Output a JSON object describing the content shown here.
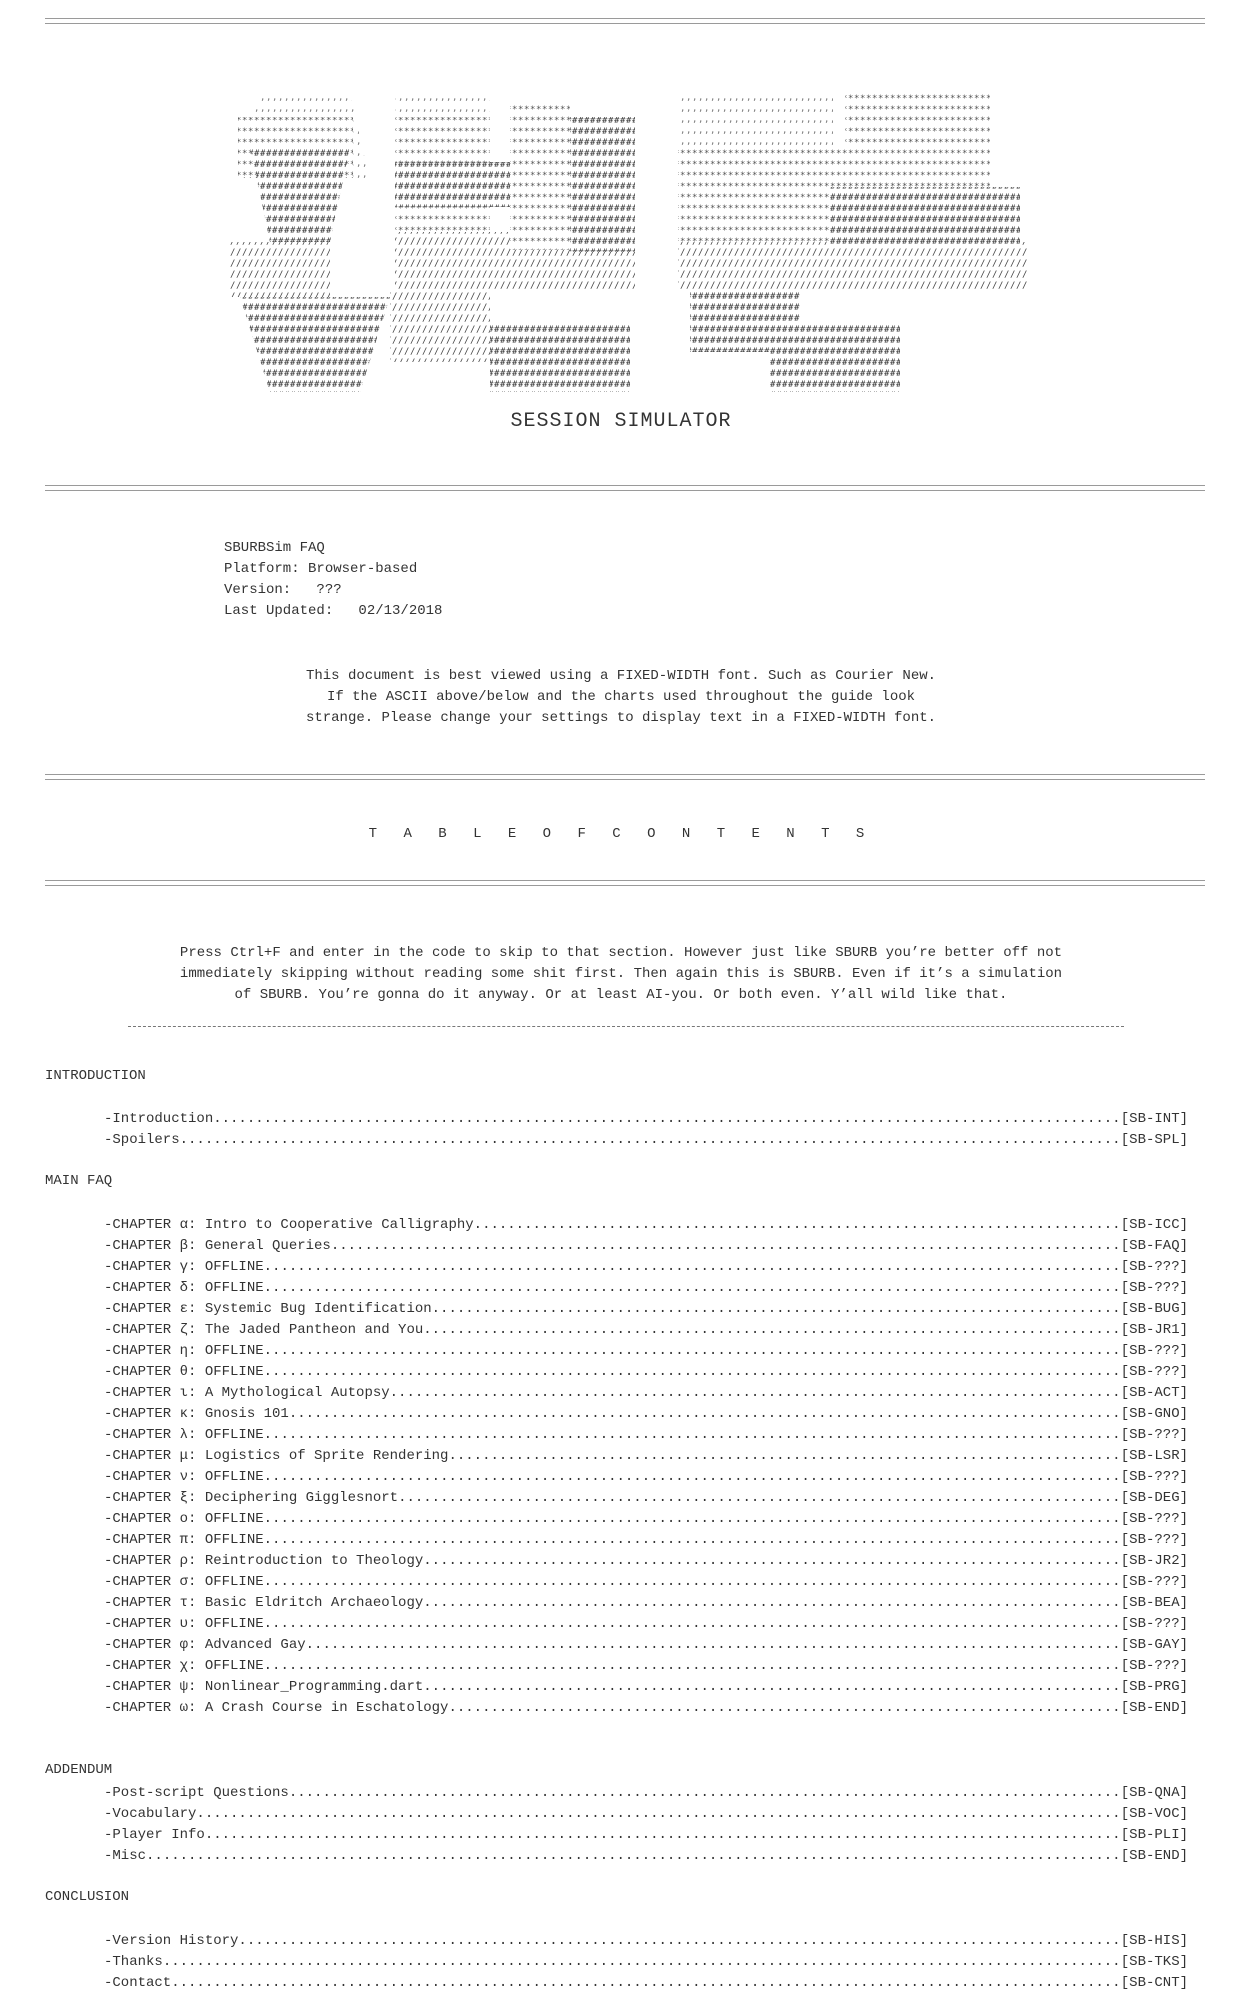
{
  "logo": {
    "title": "SESSION SIMULATOR",
    "image_alt": "SBURB ASCII art logo"
  },
  "meta": {
    "name": "SBURBSim FAQ",
    "platform": "Platform: Browser-based",
    "version": "Version:   ???",
    "updated": "Last Updated:   02/13/2018"
  },
  "notice": [
    "This document is best viewed using a FIXED-WIDTH font. Such as Courier New.",
    "If the ASCII above/below and the charts used throughout the guide look",
    "strange. Please change your settings to display text in a FIXED-WIDTH font."
  ],
  "toc_title": "T A B L E   O F   C O N T E N T S",
  "intro_text": [
    "Press Ctrl+F and enter in the code to skip to that section. However just like SBURB you’re better off not",
    "immediately skipping without reading some shit first. Then again this is SBURB. Even if it’s a simulation",
    "of SBURB. You’re gonna do it anyway. Or at least AI-you. Or both even. Y’all wild like that."
  ],
  "sections": {
    "introduction": {
      "heading": "INTRODUCTION",
      "entries": [
        {
          "label": "-Introduction",
          "code": "[SB-INT]"
        },
        {
          "label": "-Spoilers",
          "code": "[SB-SPL]"
        }
      ]
    },
    "main_faq": {
      "heading": "MAIN FAQ",
      "entries": [
        {
          "label": "-CHAPTER α: Intro to Cooperative Calligraphy",
          "code": "[SB-ICC]"
        },
        {
          "label": "-CHAPTER β: General Queries",
          "code": "[SB-FAQ]"
        },
        {
          "label": "-CHAPTER γ: OFFLINE",
          "code": "[SB-???]"
        },
        {
          "label": "-CHAPTER δ: OFFLINE",
          "code": "[SB-???]"
        },
        {
          "label": "-CHAPTER ε: Systemic Bug Identification",
          "code": "[SB-BUG]"
        },
        {
          "label": "-CHAPTER ζ: The Jaded Pantheon and You",
          "code": "[SB-JR1]"
        },
        {
          "label": "-CHAPTER η: OFFLINE",
          "code": "[SB-???]"
        },
        {
          "label": "-CHAPTER θ: OFFLINE",
          "code": "[SB-???]"
        },
        {
          "label": "-CHAPTER ι: A Mythological Autopsy",
          "code": "[SB-ACT]"
        },
        {
          "label": "-CHAPTER κ: Gnosis 101",
          "code": "[SB-GNO]"
        },
        {
          "label": "-CHAPTER λ: OFFLINE",
          "code": "[SB-???]"
        },
        {
          "label": "-CHAPTER μ: Logistics of Sprite Rendering",
          "code": "[SB-LSR]"
        },
        {
          "label": "-CHAPTER ν: OFFLINE",
          "code": "[SB-???]"
        },
        {
          "label": "-CHAPTER ξ: Deciphering Gigglesnort",
          "code": "[SB-DEG]"
        },
        {
          "label": "-CHAPTER ο: OFFLINE",
          "code": "[SB-???]"
        },
        {
          "label": "-CHAPTER π: OFFLINE",
          "code": "[SB-???]"
        },
        {
          "label": "-CHAPTER ρ: Reintroduction to Theology",
          "code": "[SB-JR2]"
        },
        {
          "label": "-CHAPTER σ: OFFLINE",
          "code": "[SB-???]"
        },
        {
          "label": "-CHAPTER τ: Basic Eldritch Archaeology",
          "code": "[SB-BEA]"
        },
        {
          "label": "-CHAPTER υ: OFFLINE",
          "code": "[SB-???]"
        },
        {
          "label": "-CHAPTER φ: Advanced Gay",
          "code": "[SB-GAY]"
        },
        {
          "label": "-CHAPTER χ: OFFLINE",
          "code": "[SB-???]"
        },
        {
          "label": "-CHAPTER ψ: Nonlinear_Programming.dart",
          "code": "[SB-PRG]"
        },
        {
          "label": "-CHAPTER ω: A Crash Course in Eschatology",
          "code": "[SB-END]"
        }
      ]
    },
    "addendum": {
      "heading": "ADDENDUM",
      "entries": [
        {
          "label": "-Post-script Questions",
          "code": "[SB-QNA]"
        },
        {
          "label": "-Vocabulary",
          "code": "[SB-VOC]"
        },
        {
          "label": "-Player Info",
          "code": "[SB-PLI]"
        },
        {
          "label": "-Misc",
          "code": "[SB-END]"
        }
      ]
    },
    "conclusion": {
      "heading": "CONCLUSION",
      "entries": [
        {
          "label": "-Version History",
          "code": "[SB-HIS]"
        },
        {
          "label": "-Thanks",
          "code": "[SB-TKS]"
        },
        {
          "label": "-Contact",
          "code": "[SB-CNT]"
        }
      ]
    }
  }
}
